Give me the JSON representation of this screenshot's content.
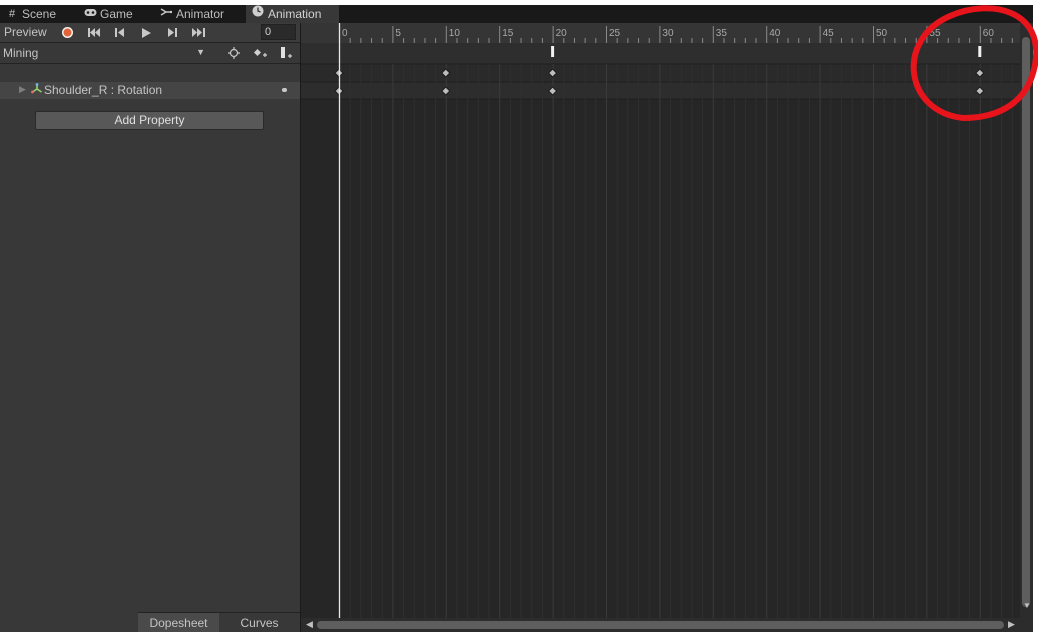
{
  "tabs": [
    {
      "label": "Scene",
      "icon": "grid-icon"
    },
    {
      "label": "Game",
      "icon": "gamepad-icon"
    },
    {
      "label": "Animator",
      "icon": "state-machine-icon"
    },
    {
      "label": "Animation",
      "icon": "clock-icon"
    }
  ],
  "toolbar": {
    "preview_label": "Preview",
    "frame_value": "0"
  },
  "clip": {
    "selected": "Mining"
  },
  "property": {
    "name": "Shoulder_R : Rotation"
  },
  "add_property_label": "Add Property",
  "bottom_tabs": {
    "dopesheet": "Dopesheet",
    "curves": "Curves"
  },
  "timeline": {
    "tick_labels": [
      "0",
      "5",
      "10",
      "15",
      "20",
      "25",
      "30",
      "35",
      "40",
      "45",
      "50",
      "55",
      "60"
    ],
    "frames_start": 0,
    "frames_end": 63,
    "keyframes": [
      0,
      10,
      20,
      60
    ],
    "event_markers": [
      20,
      60
    ],
    "playhead_frame": 0
  },
  "colors": {
    "record_button": "#e0653a",
    "annotation_circle": "#e8141b",
    "property_icon": "#9ad16e"
  }
}
